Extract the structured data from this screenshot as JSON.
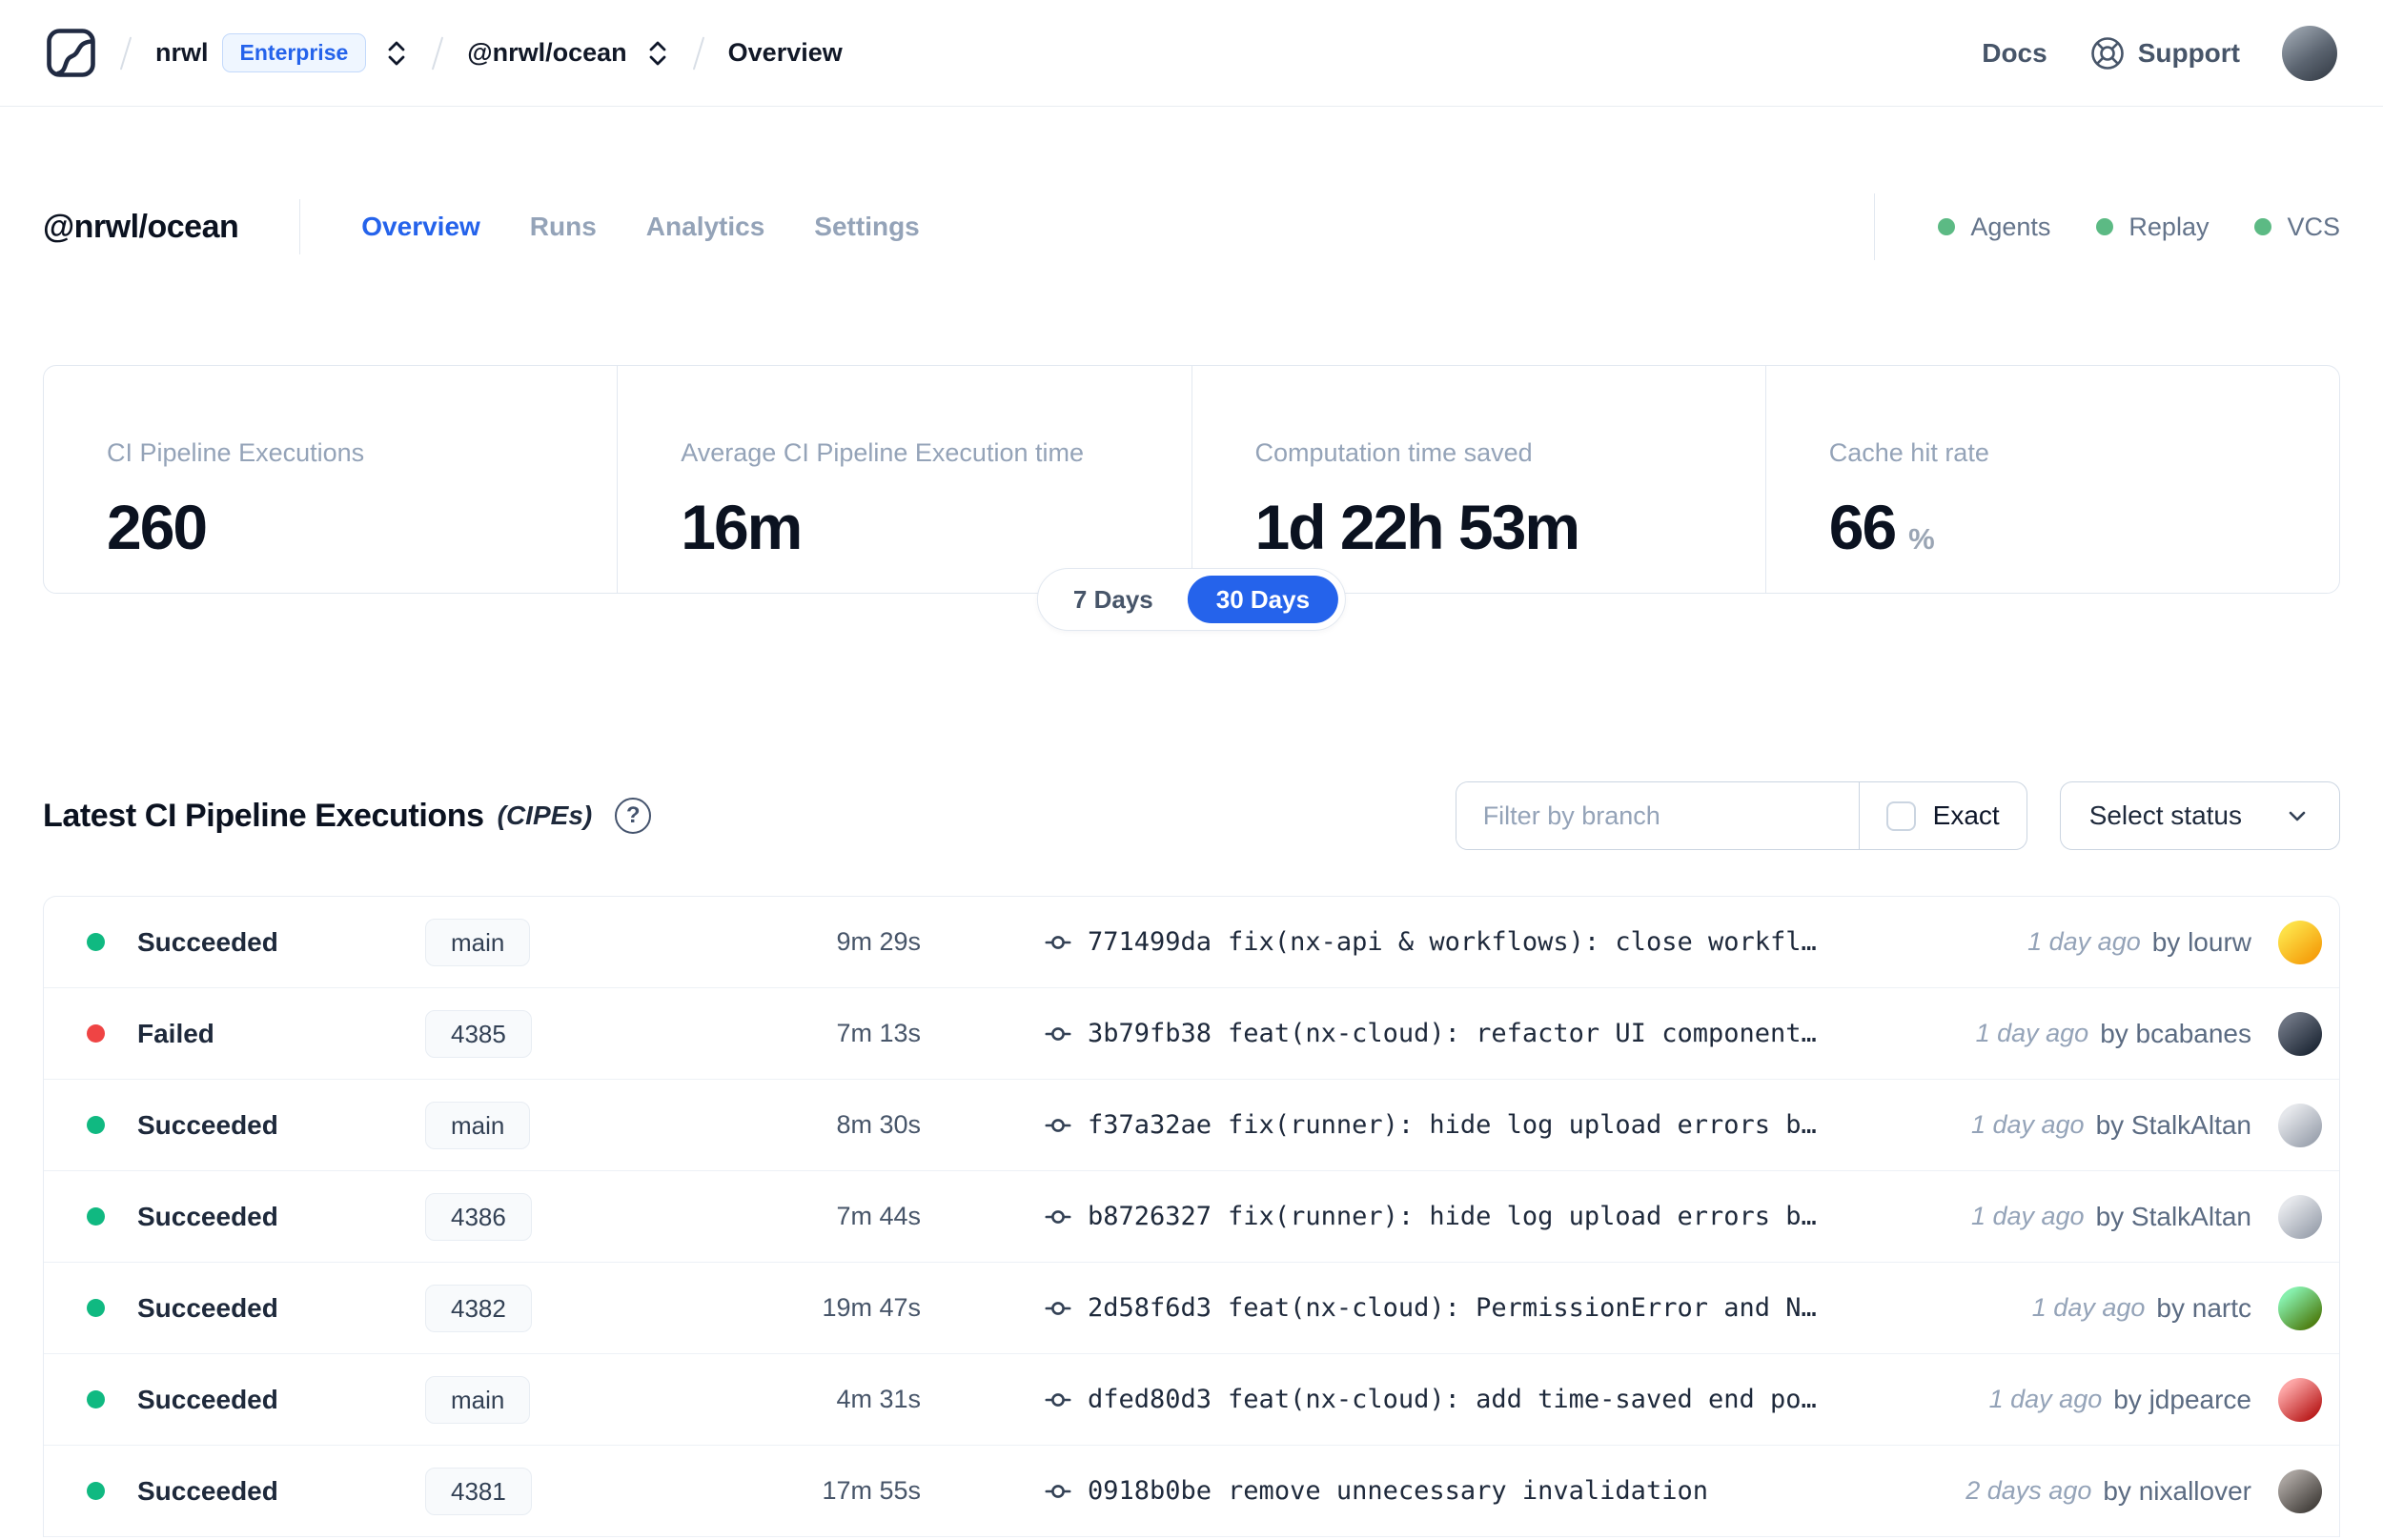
{
  "colors": {
    "accent": "#2563eb",
    "header_status_dot": "#5cba84",
    "nav_avatar": [
      "#aab3bd",
      "#2f3640"
    ]
  },
  "navbar": {
    "logo": "nx-cloud-logo",
    "breadcrumb": {
      "org": "nrwl",
      "org_badge": "Enterprise",
      "workspace": "@nrwl/ocean",
      "page": "Overview"
    },
    "links": {
      "docs": "Docs",
      "support": "Support"
    }
  },
  "header": {
    "title": "@nrwl/ocean",
    "tabs": [
      {
        "label": "Overview",
        "active": true
      },
      {
        "label": "Runs",
        "active": false
      },
      {
        "label": "Analytics",
        "active": false
      },
      {
        "label": "Settings",
        "active": false
      }
    ],
    "statuses": [
      {
        "label": "Agents"
      },
      {
        "label": "Replay"
      },
      {
        "label": "VCS"
      }
    ]
  },
  "stats": {
    "cards": [
      {
        "label": "CI Pipeline Executions",
        "value": "260",
        "suffix": ""
      },
      {
        "label": "Average CI Pipeline Execution time",
        "value": "16m",
        "suffix": ""
      },
      {
        "label": "Computation time saved",
        "value": "1d 22h 53m",
        "suffix": ""
      },
      {
        "label": "Cache hit rate",
        "value": "66",
        "suffix": "%"
      }
    ],
    "range_toggle": {
      "options": [
        "7 Days",
        "30 Days"
      ],
      "selected": "30 Days"
    }
  },
  "cipe_section": {
    "title": "Latest CI Pipeline Executions",
    "title_suffix": "(CIPEs)",
    "help_glyph": "?",
    "filter_placeholder": "Filter by branch",
    "filter_value": "",
    "exact_label": "Exact",
    "exact_checked": false,
    "status_select_label": "Select status"
  },
  "table": {
    "status_colors": {
      "Succeeded": "#10b981",
      "Failed": "#ef4444"
    },
    "rows": [
      {
        "status": "Succeeded",
        "branch": "main",
        "duration": "9m 29s",
        "commit_hash": "771499da",
        "commit_message": "fix(nx-api & workflows): close workfl…",
        "time_ago": "1 day ago",
        "author": "by lourw",
        "avatar_colors": [
          "#fde047",
          "#f59e0b"
        ]
      },
      {
        "status": "Failed",
        "branch": "4385",
        "duration": "7m 13s",
        "commit_hash": "3b79fb38",
        "commit_message": "feat(nx-cloud): refactor UI component…",
        "time_ago": "1 day ago",
        "author": "by bcabanes",
        "avatar_colors": [
          "#6b7280",
          "#1f2937"
        ]
      },
      {
        "status": "Succeeded",
        "branch": "main",
        "duration": "8m 30s",
        "commit_hash": "f37a32ae",
        "commit_message": "fix(runner): hide log upload errors b…",
        "time_ago": "1 day ago",
        "author": "by StalkAltan",
        "avatar_colors": [
          "#e5e7eb",
          "#9ca3af"
        ]
      },
      {
        "status": "Succeeded",
        "branch": "4386",
        "duration": "7m 44s",
        "commit_hash": "b8726327",
        "commit_message": "fix(runner): hide log upload errors b…",
        "time_ago": "1 day ago",
        "author": "by StalkAltan",
        "avatar_colors": [
          "#e5e7eb",
          "#9ca3af"
        ]
      },
      {
        "status": "Succeeded",
        "branch": "4382",
        "duration": "19m 47s",
        "commit_hash": "2d58f6d3",
        "commit_message": "feat(nx-cloud): PermissionError and N…",
        "time_ago": "1 day ago",
        "author": "by nartc",
        "avatar_colors": [
          "#86efac",
          "#4d7c0f"
        ]
      },
      {
        "status": "Succeeded",
        "branch": "main",
        "duration": "4m 31s",
        "commit_hash": "dfed80d3",
        "commit_message": "feat(nx-cloud): add time-saved end po…",
        "time_ago": "1 day ago",
        "author": "by jdpearce",
        "avatar_colors": [
          "#fca5a5",
          "#b91c1c"
        ]
      },
      {
        "status": "Succeeded",
        "branch": "4381",
        "duration": "17m 55s",
        "commit_hash": "0918b0be",
        "commit_message": "remove unnecessary invalidation",
        "time_ago": "2 days ago",
        "author": "by nixallover",
        "avatar_colors": [
          "#a8a29e",
          "#44403c"
        ]
      }
    ]
  }
}
